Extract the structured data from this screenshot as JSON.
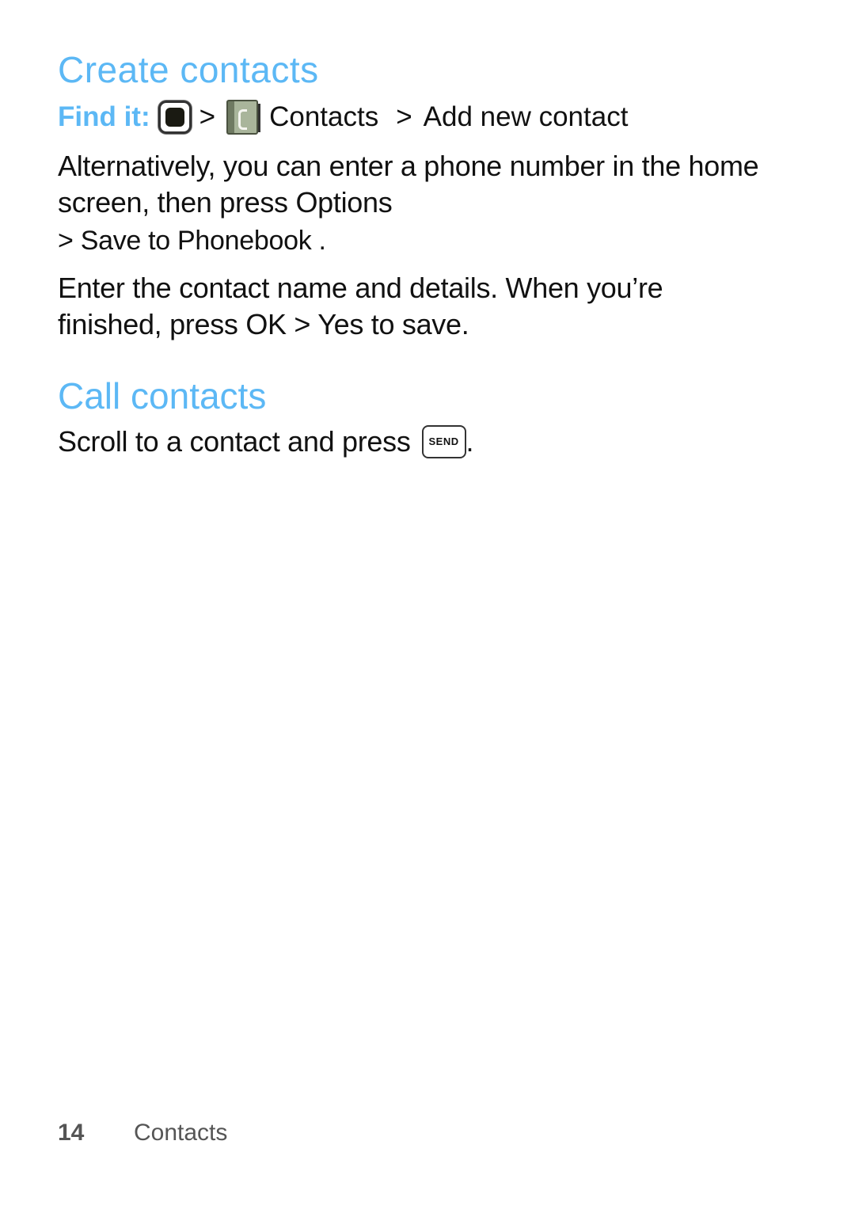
{
  "section1": {
    "title": "Create contacts",
    "find_it": {
      "label": "Find it:",
      "icons": [
        "menu-key-icon",
        "contacts-app-icon"
      ],
      "separator": ">",
      "steps": [
        "Contacts",
        "Add new contact"
      ]
    },
    "para1_line1": "Alternatively, you can enter a phone number in the home screen, then press Options",
    "para1_line2": "> Save to Phonebook  .",
    "para2": "Enter the contact name and details. When you’re finished, press OK > Yes to save."
  },
  "section2": {
    "title": "Call contacts",
    "para": "Scroll to a contact and press",
    "key_label": "SEND",
    "trailing": "."
  },
  "footer": {
    "page_number": "14",
    "chapter": "Contacts"
  },
  "colors": {
    "heading": "#5cb8f5",
    "body_text": "#111111",
    "footer_text": "#555555"
  }
}
